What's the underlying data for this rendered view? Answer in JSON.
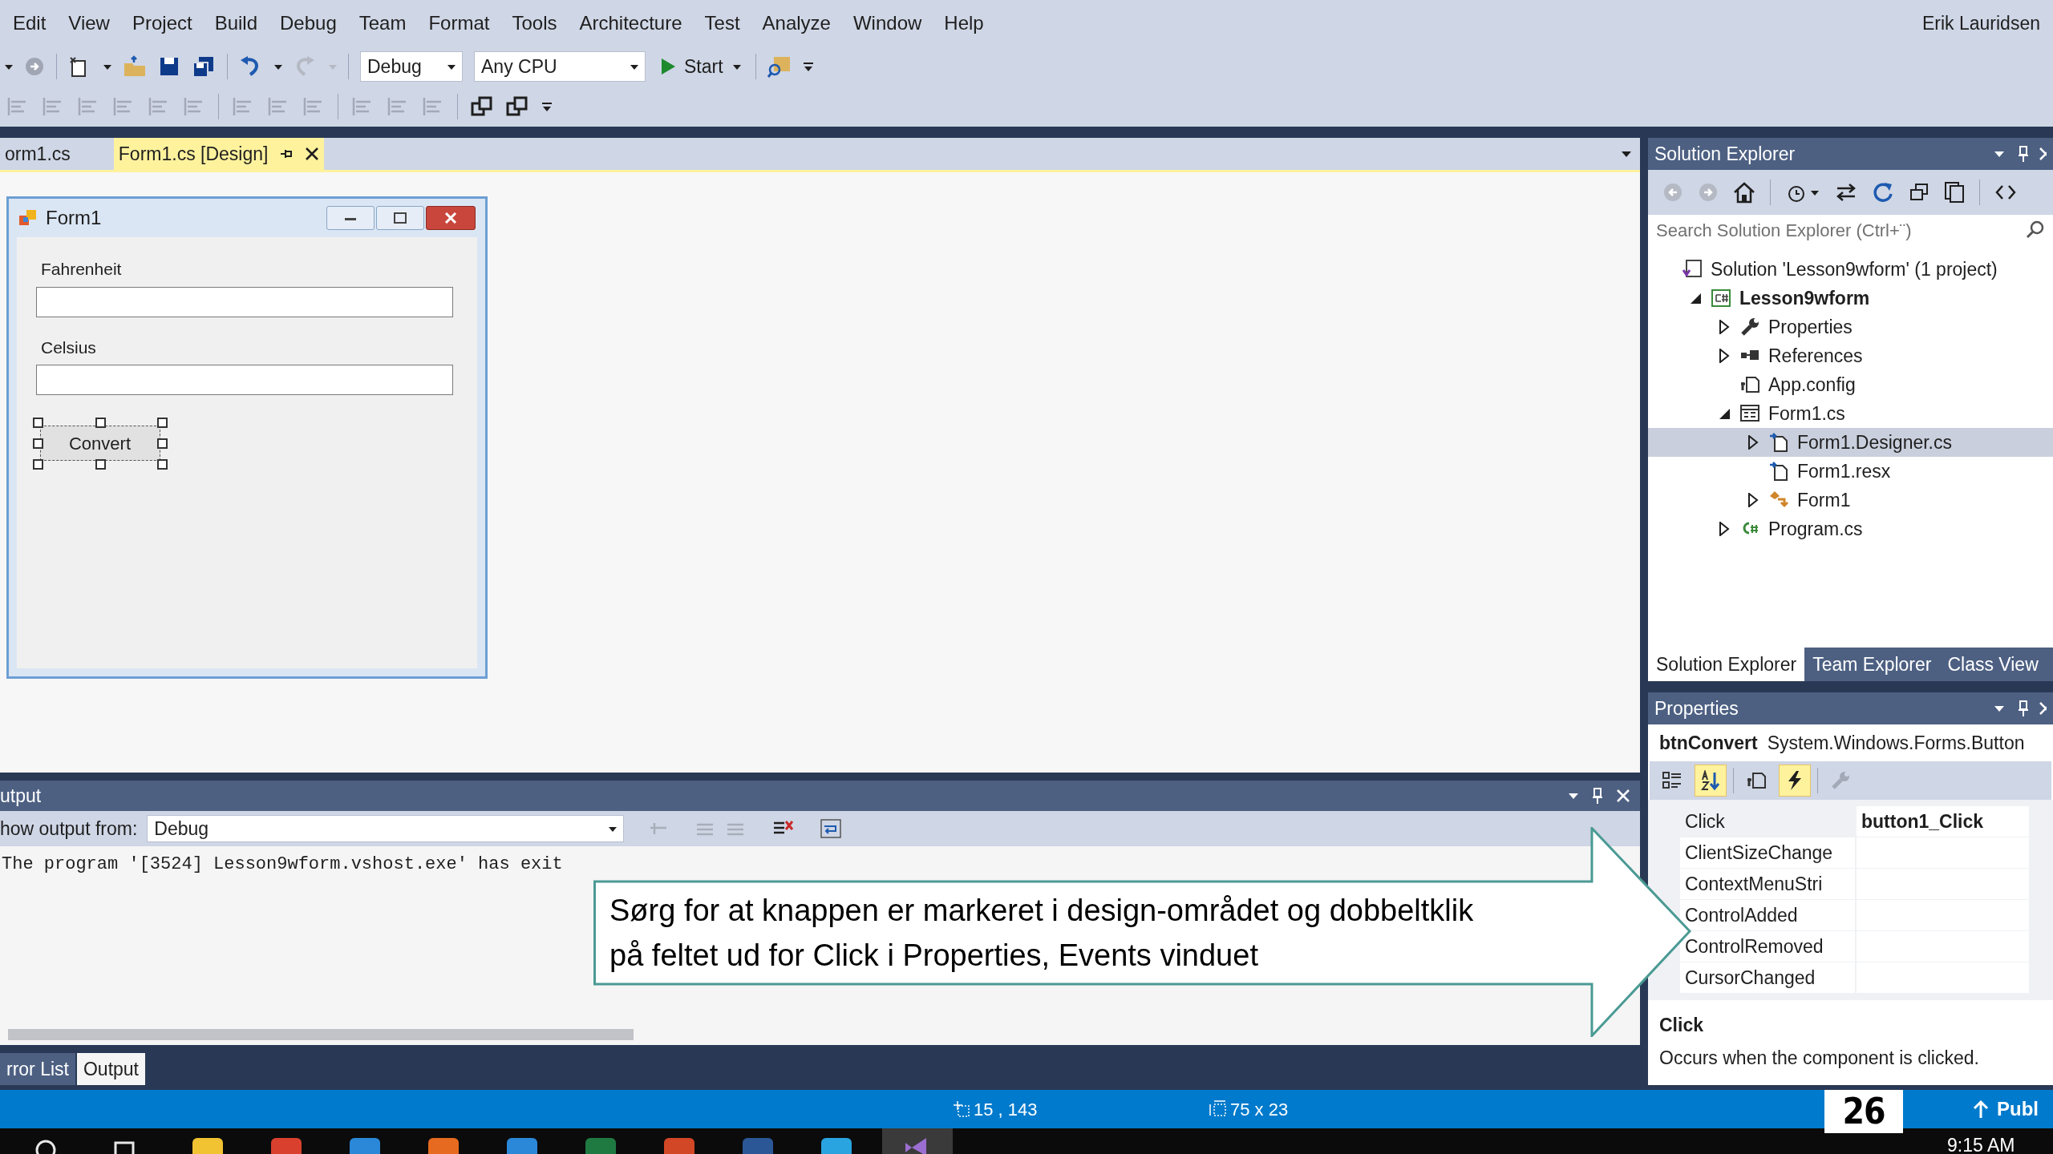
{
  "menu": [
    "Edit",
    "View",
    "Project",
    "Build",
    "Debug",
    "Team",
    "Format",
    "Tools",
    "Architecture",
    "Test",
    "Analyze",
    "Window",
    "Help"
  ],
  "user": "Erik Lauridsen",
  "toolbar": {
    "configuration": "Debug",
    "platform": "Any CPU",
    "start": "Start"
  },
  "document_tabs": [
    {
      "label": "orm1.cs",
      "selected": false
    },
    {
      "label": "Form1.cs [Design]",
      "selected": true
    }
  ],
  "form": {
    "title": "Form1",
    "fields": [
      {
        "label": "Fahrenheit"
      },
      {
        "label": "Celsius"
      }
    ],
    "button": {
      "label": "Convert",
      "selected": true
    }
  },
  "output": {
    "title": "utput",
    "source_label": "how output from:",
    "source": "Debug",
    "lines": [
      "The program '[3524] Lesson9wform.vshost.exe' has exit"
    ]
  },
  "bottom_tabs": [
    {
      "label": "rror List",
      "selected": false
    },
    {
      "label": "Output",
      "selected": true
    }
  ],
  "solution_explorer": {
    "title": "Solution Explorer",
    "search": {
      "placeholder": "Search Solution Explorer (Ctrl+¨)"
    },
    "tree": [
      {
        "label": "Solution 'Lesson9wform' (1 project)",
        "kind": "solution",
        "expandable": false,
        "selected": false,
        "children": [
          {
            "label": "Lesson9wform",
            "kind": "project",
            "expandable": true,
            "expanded": true,
            "selected": false,
            "children": [
              {
                "label": "Properties",
                "kind": "properties",
                "expandable": true,
                "expanded": false,
                "selected": false
              },
              {
                "label": "References",
                "kind": "references",
                "expandable": true,
                "expanded": false,
                "selected": false
              },
              {
                "label": "App.config",
                "kind": "config",
                "expandable": false,
                "selected": false
              },
              {
                "label": "Form1.cs",
                "kind": "form",
                "expandable": true,
                "expanded": true,
                "selected": false,
                "children": [
                  {
                    "label": "Form1.Designer.cs",
                    "kind": "codefile",
                    "expandable": true,
                    "expanded": false,
                    "selected": true
                  },
                  {
                    "label": "Form1.resx",
                    "kind": "codefile",
                    "expandable": false,
                    "selected": false
                  },
                  {
                    "label": "Form1",
                    "kind": "class",
                    "expandable": true,
                    "expanded": false,
                    "selected": false
                  }
                ]
              },
              {
                "label": "Program.cs",
                "kind": "csharp",
                "expandable": true,
                "expanded": false,
                "selected": false
              }
            ]
          }
        ]
      }
    ],
    "tabs": [
      {
        "label": "Solution Explorer",
        "selected": true
      },
      {
        "label": "Team Explorer",
        "selected": false
      },
      {
        "label": "Class View",
        "selected": false
      }
    ]
  },
  "properties": {
    "title": "Properties",
    "object_name": "btnConvert",
    "object_type": "System.Windows.Forms.Button",
    "toolbar": [
      {
        "kind": "categorized",
        "selected": false
      },
      {
        "kind": "alphabetical",
        "selected": true
      },
      {
        "kind": "properties",
        "selected": false
      },
      {
        "kind": "events",
        "selected": true
      },
      {
        "kind": "pages",
        "selected": false
      }
    ],
    "rows": [
      {
        "name": "Click",
        "value": "button1_Click",
        "selected": true
      },
      {
        "name": "ClientSizeChange",
        "selected": false
      },
      {
        "name": "ContextMenuStri",
        "selected": false
      },
      {
        "name": "ControlAdded",
        "selected": false
      },
      {
        "name": "ControlRemoved",
        "selected": false
      },
      {
        "name": "CursorChanged",
        "selected": false
      }
    ],
    "description_title": "Click",
    "description": "Occurs when the component is clicked."
  },
  "status_bar": {
    "position": "15 , 143",
    "size": "75 x 23",
    "publish": "Publ"
  },
  "page_number": "26",
  "clock": "9:15 AM",
  "callout": "Sørg for at knappen er markeret i design-området og dobbeltklik på feltet ud for Click i Properties, Events vinduet"
}
